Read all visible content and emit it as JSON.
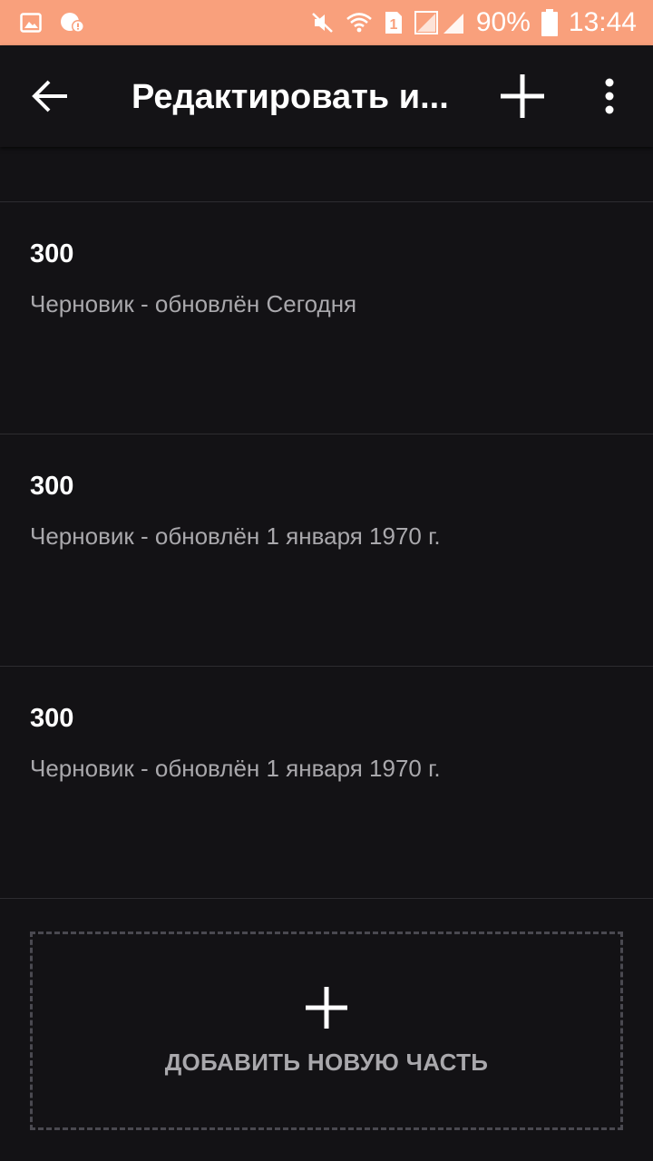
{
  "status_bar": {
    "battery": "90%",
    "time": "13:44",
    "sim_slot": "1",
    "icons": [
      "image-icon",
      "notification-icon",
      "mute-icon",
      "wifi-icon",
      "sim-icon",
      "signal-icon",
      "battery-icon"
    ]
  },
  "app_bar": {
    "title": "Редактировать и...",
    "icons": [
      "back-arrow-icon",
      "plus-icon",
      "more-vert-icon"
    ]
  },
  "parts": [
    {
      "title": "300",
      "subtitle": "Черновик - обновлён Сегодня"
    },
    {
      "title": "300",
      "subtitle": "Черновик - обновлён 1 января 1970 г."
    },
    {
      "title": "300",
      "subtitle": "Черновик - обновлён 1 января 1970 г."
    }
  ],
  "add_part": {
    "label": "ДОБАВИТЬ НОВУЮ ЧАСТЬ"
  },
  "colors": {
    "status_bar": "#f9a07c",
    "background": "#131215",
    "subtitle_text": "#a9a8ac",
    "divider": "#2d2c30"
  }
}
